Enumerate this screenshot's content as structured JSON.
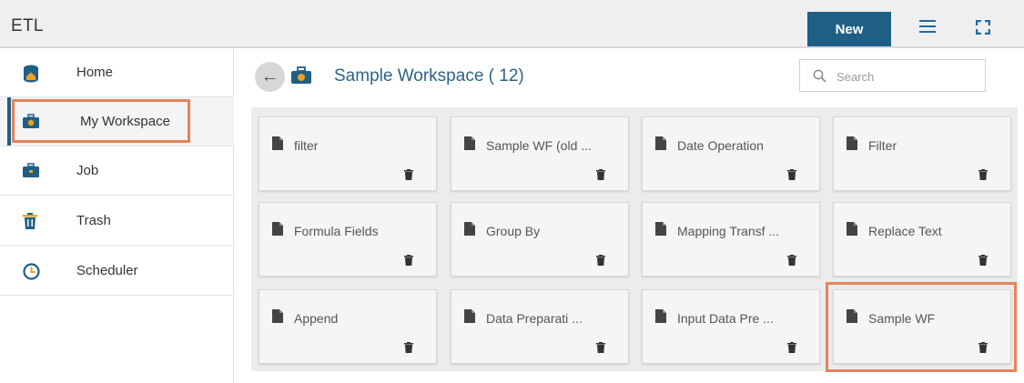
{
  "header": {
    "app_title": "ETL",
    "new_button_label": "New",
    "list_view_icon": "list-icon",
    "fullscreen_icon": "expand-icon"
  },
  "sidebar": {
    "items": [
      {
        "label": "Home",
        "icon": "home-database-icon",
        "active": false
      },
      {
        "label": "My Workspace",
        "icon": "briefcase-icon",
        "active": true
      },
      {
        "label": "Job",
        "icon": "briefcase-icon",
        "active": false
      },
      {
        "label": "Trash",
        "icon": "trash-icon",
        "active": false
      },
      {
        "label": "Scheduler",
        "icon": "clock-icon",
        "active": false
      }
    ]
  },
  "main": {
    "title": "Sample Workspace ( 12)",
    "search_placeholder": "Search",
    "cards": [
      {
        "name": "filter"
      },
      {
        "name": "Sample WF (old ..."
      },
      {
        "name": "Date Operation"
      },
      {
        "name": "Filter"
      },
      {
        "name": "Formula Fields"
      },
      {
        "name": "Group By"
      },
      {
        "name": "Mapping Transf ..."
      },
      {
        "name": "Replace Text"
      },
      {
        "name": "Append"
      },
      {
        "name": "Data Preparati ..."
      },
      {
        "name": "Input Data Pre ..."
      },
      {
        "name": "Sample WF"
      }
    ]
  },
  "colors": {
    "accent": "#1f5f86",
    "highlight": "#e8825a",
    "title_text": "#2c6387"
  }
}
